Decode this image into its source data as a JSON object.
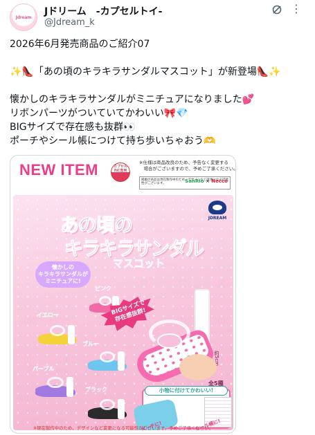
{
  "account": {
    "avatar_text": "Jdream",
    "name": "Jドリーム　-カプセルトイ-",
    "handle": "@Jdream_k",
    "grok_icon": "grok-icon",
    "more_icon": "more-icon"
  },
  "tweet": {
    "line1": "2026年6月発売商品のご紹介07",
    "line2": "✨👠「あの頃のキラキラサンダルマスコット」が新登場👠✨",
    "line3": "懐かしのキラキラサンダルがミニチュアになりました💕",
    "line4": "リボンパーツがついていてかわいい🎀💎",
    "line5": "BIGサイズで存在感も抜群👀",
    "line6": "ポーチやシール帳につけて持ち歩いちゃおう🫶"
  },
  "media": {
    "new_item": "NEW ITEM",
    "capsule_badge": "カプセルINC専用",
    "notice_line1": "※仕様は商品改良のため、予告なく変更する",
    "notice_line2": "　場合がございますので、予めご了承ください。",
    "collab_text": "掲載の商品は現在製作中のため、デザインなど変更になる可能性がございます。",
    "sanrio": "SanRio",
    "cross": "×",
    "necco": "Necco",
    "brand": "JDREAM",
    "title_line1": "あの頃の",
    "title_line2": "キラキラサンダル",
    "title_line3": "マスコット",
    "bubble_line1": "懐かしの",
    "bubble_line2": "キラキラサンダルが",
    "bubble_line3": "ミニチュアに!",
    "starburst_line1": "BIGサイズで",
    "starburst_line2": "存在感抜群!",
    "size": "約5cm",
    "total": "全5種",
    "variants": [
      "ピンク",
      "イエロー",
      "ブルー",
      "パープル",
      "ブラック"
    ],
    "accessory_title": "小物に付けてかわいい!",
    "pouch_label": "ポーチに!",
    "book_label": "シール帳に!",
    "disclaimer": "※現在製作中のため、デザインなど変更になる可能性がございます。予めご了承ください。"
  },
  "colors": {
    "pink": "#f06aa8",
    "yellow": "#f5d23a",
    "blue": "#6cc6f0",
    "purple": "#a07ae0",
    "black": "#2b2b2b"
  }
}
